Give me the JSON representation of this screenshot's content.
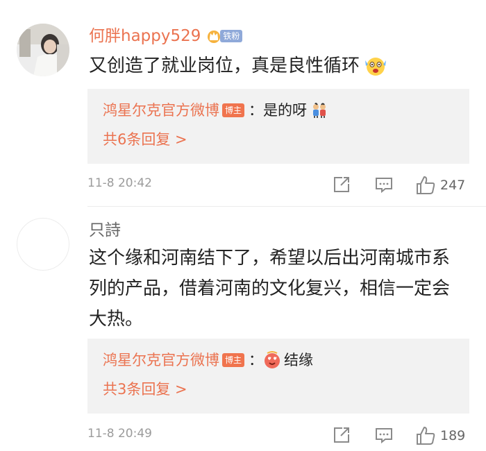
{
  "comments": [
    {
      "username": "何胖happy529",
      "fan_tag": "铁粉",
      "text": "又创造了就业岗位，真是良性循环",
      "reply": {
        "author": "鸿星尔克官方微博",
        "host_tag": "博主",
        "text": "：是的呀",
        "more": "共6条回复 >"
      },
      "time": "11-8 20:42",
      "likes": "247"
    },
    {
      "username": "只詩",
      "text": "这个缘和河南结下了，希望以后出河南城市系列的产品，借着河南的文化复兴，相信一定会大热。",
      "reply": {
        "author": "鸿星尔克官方微博",
        "host_tag": "博主",
        "text_prefix": "：",
        "text": "结缘",
        "more": "共3条回复 >"
      },
      "time": "11-8 20:49",
      "likes": "189"
    }
  ],
  "icons": [
    "crown-icon",
    "shocked-emoji-icon",
    "people-emoji-icon",
    "love-emoji-icon",
    "share-icon",
    "comment-icon",
    "like-icon"
  ],
  "colors": {
    "accent": "#eb7350",
    "fan_tag": "#8fa9d9",
    "host_tag": "#f0744e",
    "reply_bg": "#f2f2f2",
    "meta_text": "#9b9b9b"
  }
}
